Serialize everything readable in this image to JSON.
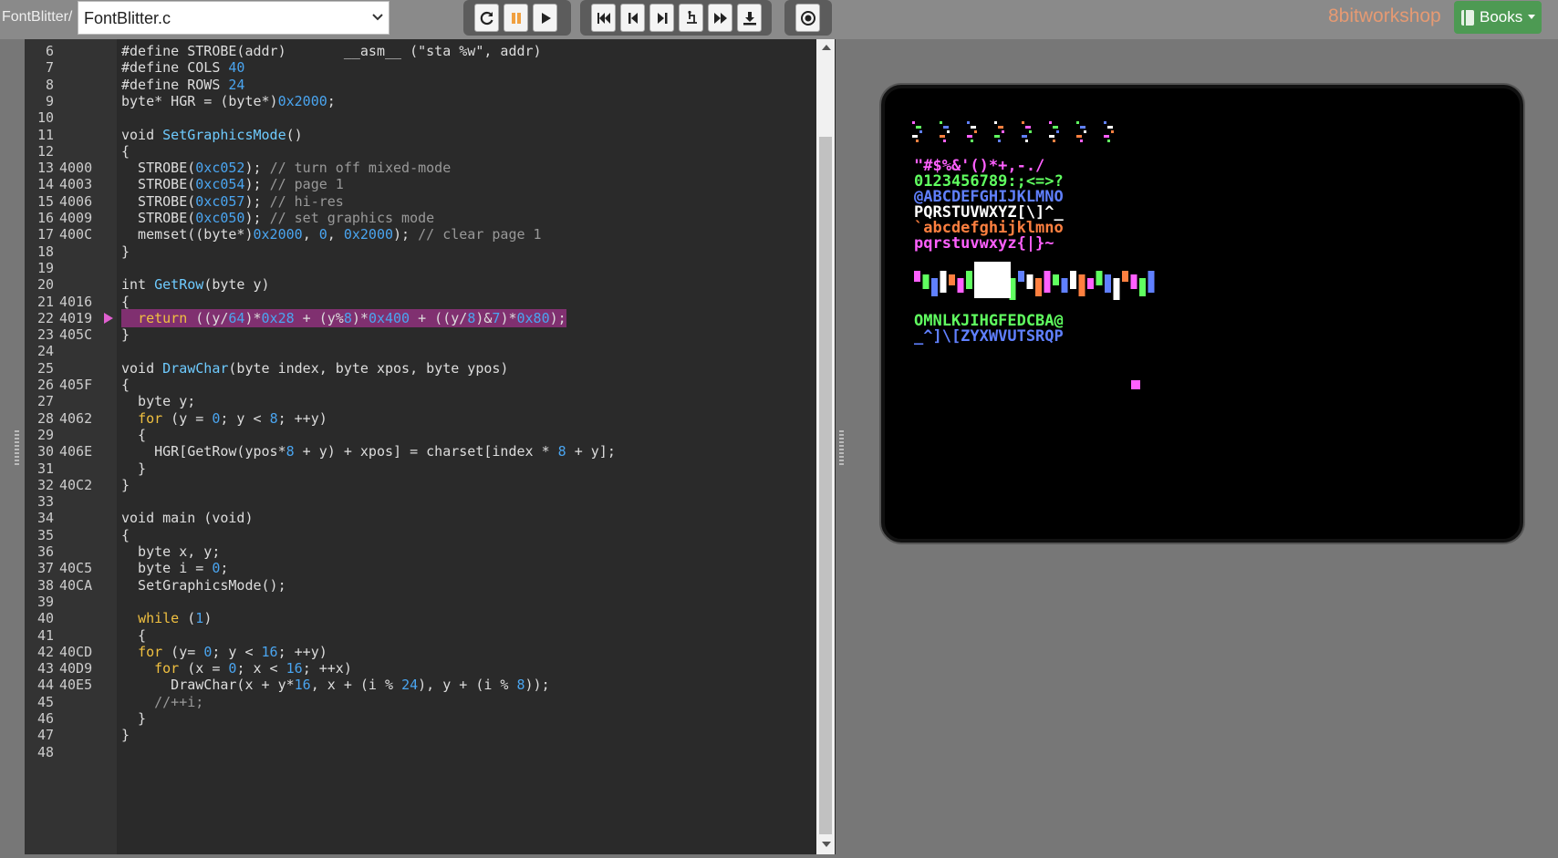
{
  "header": {
    "breadcrumb": "FontBlitter/",
    "file_selector_value": "FontBlitter.c",
    "brand": "8bitworkshop",
    "books_label": "Books"
  },
  "toolbar": {
    "groups": [
      [
        "reset-icon",
        "pause-icon",
        "play-icon"
      ],
      [
        "rewind-to-start-icon",
        "step-back-icon",
        "step-over-icon",
        "step-into-icon",
        "fast-forward-icon",
        "download-icon"
      ],
      [
        "record-icon"
      ]
    ]
  },
  "editor": {
    "current_line": 22,
    "lines": [
      {
        "n": "6",
        "addr": "",
        "code": "#define STROBE(addr)       __asm__ (\"sta %w\", addr)"
      },
      {
        "n": "7",
        "addr": "",
        "code": "#define COLS 40"
      },
      {
        "n": "8",
        "addr": "",
        "code": "#define ROWS 24"
      },
      {
        "n": "9",
        "addr": "",
        "code": "byte* HGR = (byte*)0x2000;"
      },
      {
        "n": "10",
        "addr": "",
        "code": ""
      },
      {
        "n": "11",
        "addr": "",
        "code": "void SetGraphicsMode()"
      },
      {
        "n": "12",
        "addr": "",
        "code": "{"
      },
      {
        "n": "13",
        "addr": "4000",
        "code": "  STROBE(0xc052); // turn off mixed-mode"
      },
      {
        "n": "14",
        "addr": "4003",
        "code": "  STROBE(0xc054); // page 1"
      },
      {
        "n": "15",
        "addr": "4006",
        "code": "  STROBE(0xc057); // hi-res"
      },
      {
        "n": "16",
        "addr": "4009",
        "code": "  STROBE(0xc050); // set graphics mode"
      },
      {
        "n": "17",
        "addr": "400C",
        "code": "  memset((byte*)0x2000, 0, 0x2000); // clear page 1"
      },
      {
        "n": "18",
        "addr": "",
        "code": "}"
      },
      {
        "n": "19",
        "addr": "",
        "code": ""
      },
      {
        "n": "20",
        "addr": "",
        "code": "int GetRow(byte y)"
      },
      {
        "n": "21",
        "addr": "4016",
        "code": "{"
      },
      {
        "n": "22",
        "addr": "4019",
        "code": "  return ((y/64)*0x28 + (y%8)*0x400 + ((y/8)&7)*0x80);"
      },
      {
        "n": "23",
        "addr": "405C",
        "code": "}"
      },
      {
        "n": "24",
        "addr": "",
        "code": ""
      },
      {
        "n": "25",
        "addr": "",
        "code": "void DrawChar(byte index, byte xpos, byte ypos)"
      },
      {
        "n": "26",
        "addr": "405F",
        "code": "{"
      },
      {
        "n": "27",
        "addr": "",
        "code": "  byte y;"
      },
      {
        "n": "28",
        "addr": "4062",
        "code": "  for (y = 0; y < 8; ++y)"
      },
      {
        "n": "29",
        "addr": "",
        "code": "  {"
      },
      {
        "n": "30",
        "addr": "406E",
        "code": "    HGR[GetRow(ypos*8 + y) + xpos] = charset[index * 8 + y];"
      },
      {
        "n": "31",
        "addr": "",
        "code": "  }"
      },
      {
        "n": "32",
        "addr": "40C2",
        "code": "}"
      },
      {
        "n": "33",
        "addr": "",
        "code": ""
      },
      {
        "n": "34",
        "addr": "",
        "code": "void main (void)"
      },
      {
        "n": "35",
        "addr": "",
        "code": "{"
      },
      {
        "n": "36",
        "addr": "",
        "code": "  byte x, y;"
      },
      {
        "n": "37",
        "addr": "40C5",
        "code": "  byte i = 0;"
      },
      {
        "n": "38",
        "addr": "40CA",
        "code": "  SetGraphicsMode();"
      },
      {
        "n": "39",
        "addr": "",
        "code": ""
      },
      {
        "n": "40",
        "addr": "",
        "code": "  while (1)"
      },
      {
        "n": "41",
        "addr": "",
        "code": "  {"
      },
      {
        "n": "42",
        "addr": "40CD",
        "code": "  for (y= 0; y < 16; ++y)"
      },
      {
        "n": "43",
        "addr": "40D9",
        "code": "    for (x = 0; x < 16; ++x)"
      },
      {
        "n": "44",
        "addr": "40E5",
        "code": "      DrawChar(x + y*16, x + (i % 24), y + (i % 8));"
      },
      {
        "n": "45",
        "addr": "",
        "code": "    //++i;"
      },
      {
        "n": "46",
        "addr": "",
        "code": "  }"
      },
      {
        "n": "47",
        "addr": "",
        "code": "}"
      },
      {
        "n": "48",
        "addr": "",
        "code": ""
      }
    ]
  },
  "emulator": {
    "screen_text_rows": [
      " \"#$%&'()*+,-./",
      "0123456789:;<=>?",
      "@ABCDEFGHIJKLMNO",
      "PQRSTUVWXYZ[\\]^_",
      "`abcdefghijklmno",
      "pqrstuvwxyz{|}~",
      "OMNLKJIHGFEDCBA@",
      "_^]\\[ZYXWVUTSRQP"
    ],
    "colors": [
      "#ff60ff",
      "#60ff60",
      "#6080ff",
      "#ffffff",
      "#ff8040"
    ]
  },
  "colors": {
    "highlight_bg": "#803070",
    "brand": "#e69a73",
    "books_bg": "#4d9a53"
  }
}
